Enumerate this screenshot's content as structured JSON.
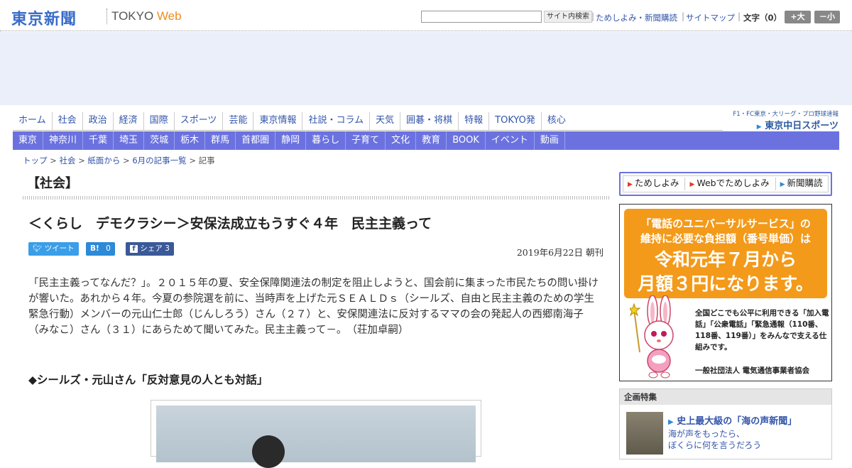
{
  "header": {
    "logo_kanji": "東京新聞",
    "logo_tokyo": "TOKYO",
    "logo_web": "Web",
    "search_button": "サイト内検索",
    "links": [
      "ためしよみ・新聞購読",
      "サイトマップ"
    ],
    "font_size_label": "文字（0）",
    "font_bigger": "+大",
    "font_smaller": "－小"
  },
  "nav_primary": [
    "ホーム",
    "社会",
    "政治",
    "経済",
    "国際",
    "スポーツ",
    "芸能",
    "東京情報",
    "社説・コラム",
    "天気",
    "囲碁・将棋",
    "特報",
    "TOKYO発",
    "核心"
  ],
  "chunichi": {
    "top": "F1・FC東京・大リーグ・プロ野球速報",
    "brand": "東京中日スポーツ"
  },
  "nav_secondary": [
    "東京",
    "神奈川",
    "千葉",
    "埼玉",
    "茨城",
    "栃木",
    "群馬",
    "首都圏",
    "静岡",
    "暮らし",
    "子育て",
    "文化",
    "教育",
    "BOOK",
    "イベント",
    "動画"
  ],
  "breadcrumb": {
    "items": [
      "トップ",
      "社会",
      "紙面から",
      "6月の記事一覧"
    ],
    "current": "記事"
  },
  "article": {
    "section": "【社会】",
    "headline": "＜くらし　デモクラシー＞安保法成立もうすぐ４年　民主主義って",
    "share": {
      "tweet": "ツイート",
      "hatena": "B!",
      "hatena_count": "0",
      "facebook": "シェア",
      "facebook_count": "3"
    },
    "date": "2019年6月22日 朝刊",
    "lead": "「民主主義ってなんだ？」。２０１５年の夏、安全保障関連法の制定を阻止しようと、国会前に集まった市民たちの問い掛けが響いた。あれから４年。今夏の参院選を前に、当時声を上げた元ＳＥＡＬＤｓ（シールズ、自由と民主主義のための学生緊急行動）メンバーの元山仁士郎（じんしろう）さん（２７）と、安保関連法に反対するママの会の発起人の西郷南海子（みなこ）さん（３１）にあらためて聞いてみた。民主主義って－。　（荘加卓嗣）",
    "subhead": "◆シールズ・元山さん「反対意見の人とも対話」"
  },
  "sidebar": {
    "tabs": [
      "ためしよみ",
      "Webでためしよみ",
      "新聞購読"
    ],
    "ad": {
      "line1": "「電話のユニバーサルサービス」の",
      "line2": "維持に必要な負担額（番号単価）は",
      "big1": "令和元年７月から",
      "big2": "月額３円になります。",
      "text": "全国どこでも公平に利用できる「加入電話」「公衆電話」「緊急通報（110番、118番、119番）」をみんなで支える仕組みです。",
      "org": "一般社団法人 電気通信事業者協会"
    },
    "special": {
      "heading": "企画特集",
      "title": "史上最大級の「海の声新聞」",
      "desc1": "海が声をもったら、",
      "desc2": "ぼくらに何を言うだろう"
    }
  }
}
